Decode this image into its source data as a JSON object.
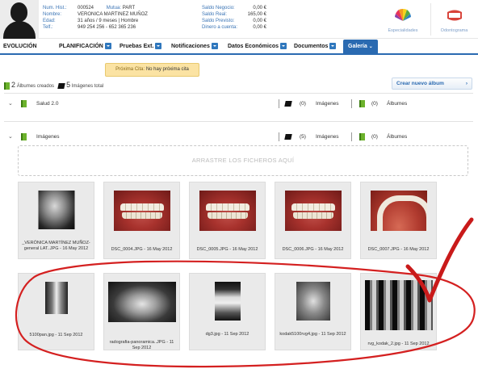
{
  "patient": {
    "labels": {
      "num_hist": "Num. Hist.:",
      "nombre": "Nombre:",
      "edad": "Edad:",
      "telf": "Telf.:",
      "mutua": "Mutua:"
    },
    "num_hist": "000524",
    "mutua": "PART",
    "nombre": "VERONICA MARTINEZ MUÑOZ",
    "edad": "31 años / 9 meses | Hombre",
    "telf": "949 254 256 - 652 365 236"
  },
  "balances": [
    {
      "label": "Saldo Negocio:",
      "value": "0,00 €"
    },
    {
      "label": "Saldo Real:",
      "value": "165,00 €"
    },
    {
      "label": "Saldo Previsto:",
      "value": "0,00 €"
    },
    {
      "label": "Dinero a cuenta:",
      "value": "0,00 €"
    }
  ],
  "header_buttons": {
    "especialidades": "Especialidades",
    "odontograma": "Odontograma"
  },
  "tabs": {
    "evolucion": "EVOLUCIÓN",
    "planificacion": "PLANIFICACIÓN",
    "pruebas": "Pruebas Ext.",
    "notificaciones": "Notificaciones",
    "economicos": "Datos Económicos",
    "documentos": "Documentos",
    "galeria": "Galería"
  },
  "next_appointment": {
    "label": "Próxima Cita:",
    "value": "No hay próxima cita"
  },
  "summary": {
    "albums_count": "2",
    "albums_label": "Álbumes creados",
    "images_count": "5",
    "images_label": "Imágenes total"
  },
  "create_album_label": "Crear nuevo álbum",
  "albums": [
    {
      "name": "Salud 2.0",
      "images_count": "(0)",
      "images_label": "Imágenes",
      "albums_count": "(0)",
      "albums_label": "Álbumes"
    },
    {
      "name": "Imágenes",
      "images_count": "(5)",
      "images_label": "Imágenes",
      "albums_count": "(0)",
      "albums_label": "Álbumes"
    }
  ],
  "dropzone_text": "ARRASTRE LOS FICHEROS AQUÍ",
  "gallery_row1": [
    {
      "caption": "_VERÓNICA MARTÍNEZ MUÑOZ-general LAT..JPG - 16 May 2012",
      "kind": "xray-side"
    },
    {
      "caption": "DSC_0004.JPG - 16 May 2012",
      "kind": "smile"
    },
    {
      "caption": "DSC_0005.JPG - 16 May 2012",
      "kind": "smile"
    },
    {
      "caption": "DSC_0006.JPG - 16 May 2012",
      "kind": "smile"
    },
    {
      "caption": "DSC_0007.JPG - 16 May 2012",
      "kind": "arch"
    }
  ],
  "gallery_row2": [
    {
      "caption": "5100pan.jpg - 11 Sep 2012",
      "kind": "xray-small"
    },
    {
      "caption": "radografia-panoramica..JPG - 11 Sep 2012",
      "kind": "pano"
    },
    {
      "caption": "dg3.jpg - 11 Sep 2012",
      "kind": "implant"
    },
    {
      "caption": "kodak5100rvg4.jpg - 11 Sep 2012",
      "kind": "kodak"
    },
    {
      "caption": "rvg_kodak_2.jpg - 11 Sep 2012",
      "kind": "rvg"
    }
  ],
  "colors": {
    "accent": "#2a6ab1",
    "annotation": "#d42020",
    "appointment_bg": "#fbe3a3"
  }
}
